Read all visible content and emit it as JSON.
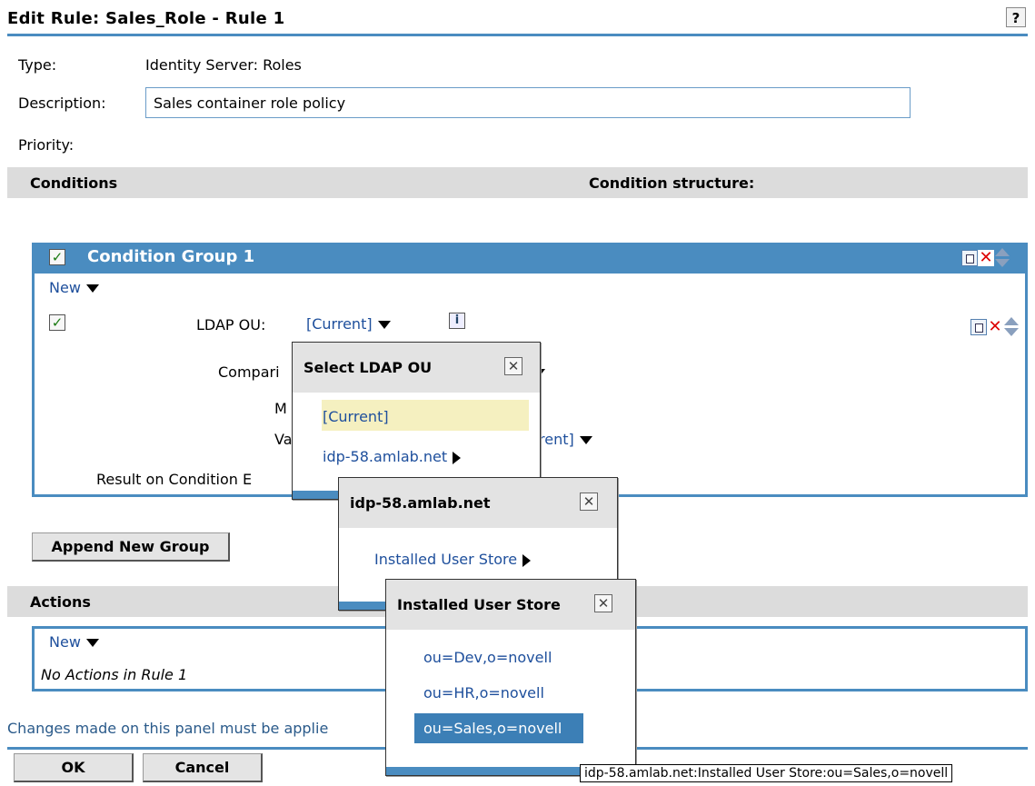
{
  "page": {
    "title": "Edit Rule: Sales_Role - Rule 1",
    "help_label": "?"
  },
  "form": {
    "type_label": "Type:",
    "type_value": "Identity Server: Roles",
    "description_label": "Description:",
    "description_value": "Sales container role policy",
    "priority_label": "Priority:"
  },
  "conditions": {
    "header": "Conditions",
    "structure_label": "Condition structure:",
    "group": {
      "title": "Condition Group 1",
      "new_label": "New",
      "condition": {
        "ldap_ou_label": "LDAP OU:",
        "ldap_ou_value": "[Current]",
        "comparison_label": "Compari",
        "m_label": "M",
        "va_label": "Va",
        "value_fragment": "rent]",
        "result_label": "Result on Condition E"
      }
    },
    "append_group_button": "Append New Group"
  },
  "actions": {
    "header": "Actions",
    "new_label": "New",
    "empty_text": "No Actions in Rule 1"
  },
  "footer": {
    "note": "Changes made on this panel must be applie",
    "ok_button": "OK",
    "cancel_button": "Cancel"
  },
  "popups": {
    "select_ou": {
      "title": "Select LDAP OU",
      "items": [
        "[Current]",
        "idp-58.amlab.net"
      ]
    },
    "server": {
      "title": "idp-58.amlab.net",
      "items": [
        "Installed User Store"
      ]
    },
    "user_store": {
      "title": "Installed User Store",
      "items": [
        "ou=Dev,o=novell",
        "ou=HR,o=novell",
        "ou=Sales,o=novell"
      ]
    }
  },
  "tooltip": "idp-58.amlab.net:Installed User Store:ou=Sales,o=novell",
  "colors": {
    "accent": "#4a8cc0",
    "link": "#1e4f9c",
    "highlight": "#f5f0c0",
    "selected": "#3c7fb6"
  }
}
